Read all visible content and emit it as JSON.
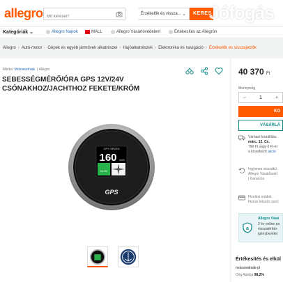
{
  "header": {
    "logo": "allegro",
    "search_placeholder": "Mit keresel?",
    "category_select": "Érzékelők és vissza...",
    "search_button": "KERES",
    "watermark": "Jófogás"
  },
  "subnav": {
    "categories": "Kategóriák",
    "items": [
      "Allegro Napok",
      "MALL",
      "Allegro Vásárlóvédelem",
      "Értékesítés az Allegrón"
    ]
  },
  "breadcrumb": [
    "Allegro",
    "Autó-motor",
    "Gépek és egyéb járművek alkatrészei",
    "Hajóalkatrészek",
    "Elektronika és navigáció",
    "Érzékelők és visszajelzők"
  ],
  "product": {
    "brand_label": "Márka:",
    "brand": "Motowodniak",
    "seller_tag": "Allegro",
    "title": "SEBESSÉGMÉRŐ/ÓRA GPS 12V/24V CSÓNAKHOZ/JACHTHOZ FEKETE/KRÓM"
  },
  "gauge": {
    "top_label": "GPS SPEED",
    "speed": "160",
    "unit": "km/h",
    "voltage": "12.3V",
    "brand": "GPS"
  },
  "purchase": {
    "price": "40 370",
    "currency": "Ft",
    "qty_label": "Mennyiség",
    "qty_minus": "−",
    "qty_value": "1",
    "qty_plus": "+",
    "cart_button": "KO",
    "buy_button": "VÁSÁRLÁ"
  },
  "shipping": {
    "line1": "Várható kiszállítás",
    "line2": "márc. 12. Cs.",
    "line3": "790 Ft vagy 0 Ft-ér",
    "line4_prefix": "a következő ",
    "line4_link": "akció"
  },
  "returns": {
    "line1": "Ingyenes visszakü",
    "line2": "Allegro Vásárlóvéd",
    "line3": "| Garancia"
  },
  "payment": {
    "line1": "Fizetési módok",
    "line2": "Fizess tetszés szeri"
  },
  "protection": {
    "title": "Allegro Vásá",
    "line1": "2 év online pa",
    "line2": "visszatérítés",
    "line3": "igénybevétel"
  },
  "seller": {
    "heading": "Értékesítés és elkül",
    "name": "motowodniak-pl",
    "rating_label": "Cég  Ajánlja",
    "rating_value": "98,2%"
  },
  "colors": {
    "accent": "#ff5a00",
    "teal": "#0f8c8c"
  }
}
